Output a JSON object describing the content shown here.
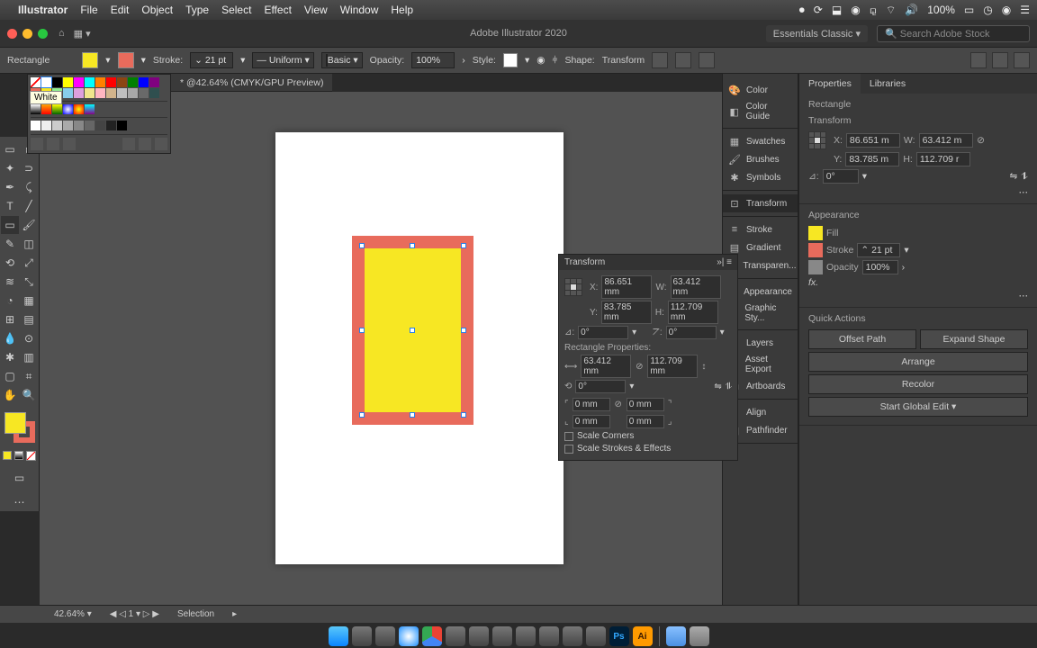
{
  "mac_menu": {
    "app": "Illustrator",
    "items": [
      "File",
      "Edit",
      "Object",
      "Type",
      "Select",
      "Effect",
      "View",
      "Window",
      "Help"
    ],
    "battery": "100%"
  },
  "window": {
    "title": "Adobe Illustrator 2020",
    "workspace": "Essentials Classic",
    "search_placeholder": "Search Adobe Stock"
  },
  "control_bar": {
    "shape": "Rectangle",
    "stroke_label": "Stroke:",
    "stroke_pt": "21 pt",
    "stroke_profile": "Uniform",
    "brush_def": "Basic",
    "opacity_label": "Opacity:",
    "opacity": "100%",
    "style_label": "Style:",
    "shape_label": "Shape:",
    "transform_label": "Transform"
  },
  "doc_tab": "42.64% (CMYK/GPU Preview)",
  "swatch_tooltip": "White",
  "transform_panel": {
    "title": "Transform",
    "x": "86.651 mm",
    "y": "83.785 mm",
    "w": "63.412 mm",
    "h": "112.709 mm",
    "angle": "0°",
    "shear": "0°",
    "rect_props": "Rectangle Properties:",
    "rw": "63.412 mm",
    "rh": "112.709 mm",
    "rot": "0°",
    "corner": "0 mm",
    "scale_corners": "Scale Corners",
    "scale_strokes": "Scale Strokes & Effects"
  },
  "dock": {
    "g1": [
      "Color",
      "Color Guide"
    ],
    "g2": [
      "Swatches",
      "Brushes",
      "Symbols"
    ],
    "g3": [
      "Transform"
    ],
    "g4": [
      "Stroke",
      "Gradient",
      "Transparen..."
    ],
    "g5": [
      "Appearance",
      "Graphic Sty..."
    ],
    "g6": [
      "Layers",
      "Asset Export",
      "Artboards"
    ],
    "g7": [
      "Align",
      "Pathfinder"
    ]
  },
  "props": {
    "tab1": "Properties",
    "tab2": "Libraries",
    "sel": "Rectangle",
    "transform_h": "Transform",
    "x": "86.651 m",
    "y": "83.785 m",
    "w": "63.412 m",
    "h": "112.709 r",
    "ang": "0°",
    "appearance_h": "Appearance",
    "fill": "Fill",
    "stroke": "Stroke",
    "stroke_pt": "21 pt",
    "opacity": "Opacity",
    "opacity_v": "100%",
    "quick_actions_h": "Quick Actions",
    "qa": [
      "Offset Path",
      "Expand Shape",
      "Arrange",
      "Recolor",
      "Start Global Edit"
    ]
  },
  "status": {
    "zoom": "42.64%",
    "mode": "Selection"
  },
  "colors": {
    "yellow": "#f7e723",
    "salmon": "#e86b5c"
  }
}
